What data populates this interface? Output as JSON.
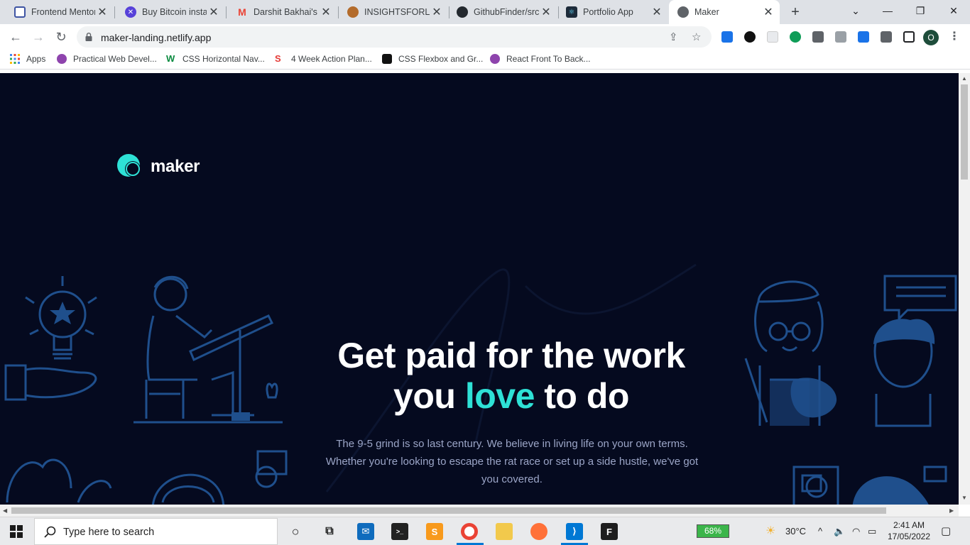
{
  "browser": {
    "tabs": [
      {
        "title": "Frontend Mentor",
        "favicon_color": "#ffffff",
        "favicon_border": "#3e54a3",
        "active": false
      },
      {
        "title": "Buy Bitcoin instantly",
        "favicon_color": "#5741d9",
        "active": false
      },
      {
        "title": "Darshit Bakhai's Z",
        "favicon_color": "#ea4335",
        "active": false
      },
      {
        "title": "INSIGHTSFORLIVING",
        "favicon_color": "#b36b2b",
        "active": false
      },
      {
        "title": "GithubFinder/src",
        "favicon_color": "#24292f",
        "active": false
      },
      {
        "title": "Portfolio App",
        "favicon_color": "#1d2b3a",
        "active": false
      },
      {
        "title": "Maker",
        "favicon_color": "#5f6368",
        "active": true
      }
    ],
    "new_tab": "+",
    "window_controls": {
      "minimize": "—",
      "restore": "❐",
      "close": "✕",
      "dropdown": "⌄"
    },
    "address": {
      "url": "maker-landing.netlify.app"
    },
    "bookmarks": [
      {
        "label": "Apps",
        "color": "#4285f4"
      },
      {
        "label": "Practical Web Devel...",
        "color": "#8e44ad"
      },
      {
        "label": "CSS Horizontal Nav...",
        "color": "#0a8a3f"
      },
      {
        "label": "4 Week Action Plan...",
        "color": "#e53935"
      },
      {
        "label": "CSS Flexbox and Gr...",
        "color": "#111111"
      },
      {
        "label": "React Front To Back...",
        "color": "#8e44ad"
      }
    ]
  },
  "page": {
    "logo_text": "maker",
    "hero": {
      "line1": "Get paid for the work",
      "line2_pre": "you ",
      "line2_accent": "love",
      "line2_post": " to do",
      "body": "The 9-5 grind is so last century. We believe in living life on your own terms. Whether you're looking to escape the rat race or set up a side hustle, we've got you covered."
    },
    "colors": {
      "background": "#050a1f",
      "accent": "#2ee1d6",
      "illustration": "#1f4f8c",
      "body_text": "#9ba5c7"
    }
  },
  "taskbar": {
    "search_placeholder": "Type here to search",
    "battery": "68%",
    "weather": "30°C",
    "time": "2:41 AM",
    "date": "17/05/2022"
  }
}
